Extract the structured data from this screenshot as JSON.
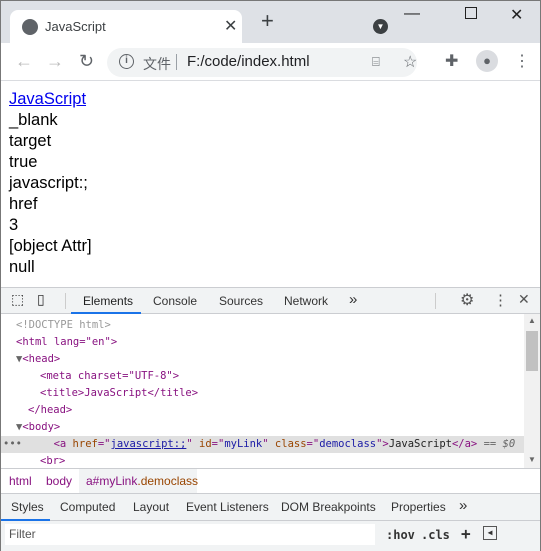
{
  "browser": {
    "tab_title": "JavaScript",
    "url_scheme_label": "文件",
    "url": "F:/code/index.html"
  },
  "page": {
    "link_text": "JavaScript",
    "lines": [
      "_blank",
      "target",
      "true",
      "javascript:;",
      "href",
      "3",
      "[object Attr]",
      "null"
    ]
  },
  "devtools": {
    "tabs": [
      "Elements",
      "Console",
      "Sources",
      "Network"
    ],
    "more": "»",
    "dom": {
      "doctype": "<!DOCTYPE html>",
      "html_open": "<html lang=\"en\">",
      "head_open": "<head>",
      "meta": "<meta charset=\"UTF-8\">",
      "title": "<title>JavaScript</title>",
      "head_close": "</head>",
      "body_open": "<body>",
      "a_href": "javascript:;",
      "a_id": "myLink",
      "a_class": "democlass",
      "a_text": "JavaScript",
      "a_suffix": " == $0",
      "br": "<br>"
    },
    "breadcrumbs": [
      "html",
      "body",
      "a#myLink",
      ".democlass"
    ],
    "style_tabs": [
      "Styles",
      "Computed",
      "Layout",
      "Event Listeners",
      "DOM Breakpoints",
      "Properties"
    ],
    "filter_placeholder": "Filter",
    "hov": ":hov",
    "cls": ".cls"
  },
  "colors": {
    "accent": "#1a73e8",
    "tag": "#881280",
    "attr": "#994500",
    "value": "#1a1aa6"
  }
}
